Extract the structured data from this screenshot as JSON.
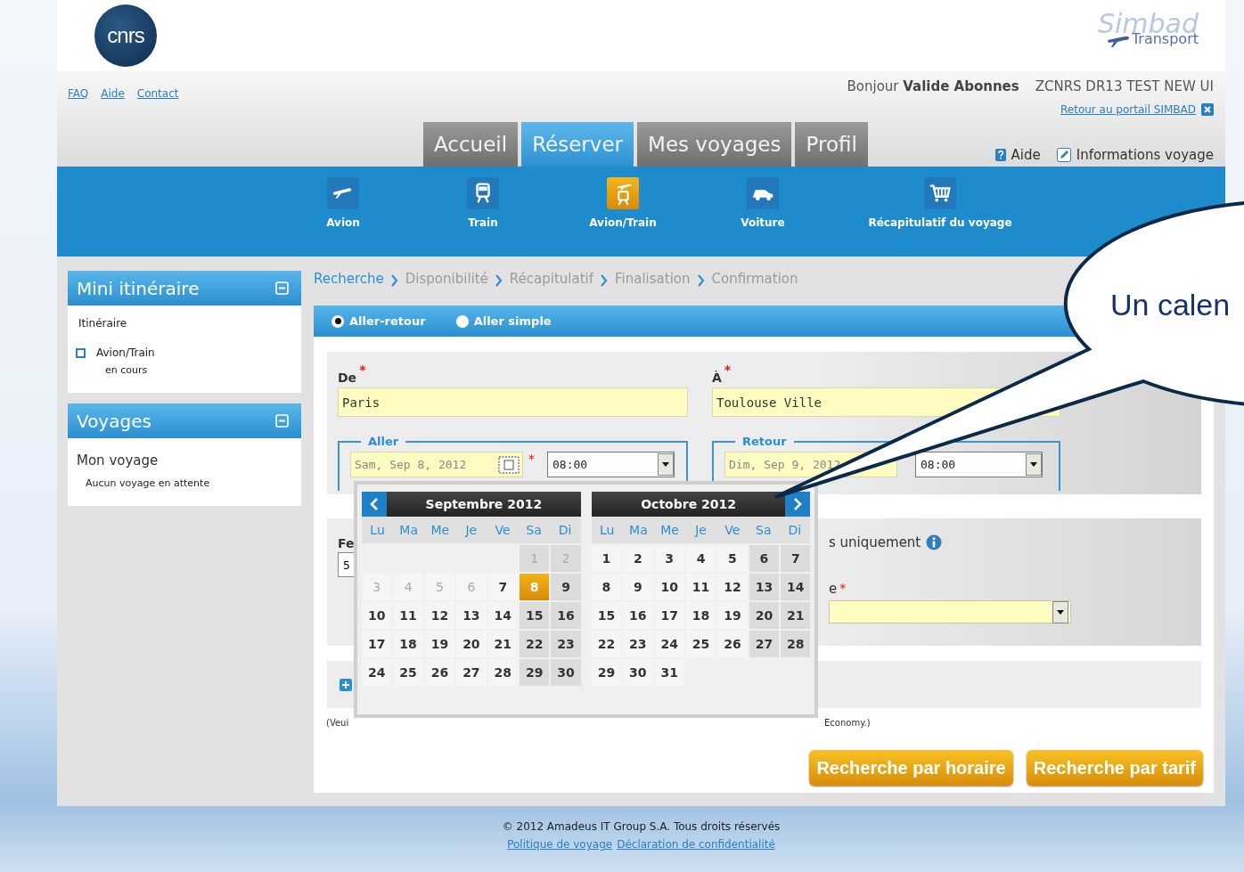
{
  "header": {
    "logo_text": "cnrs",
    "brand_logo": [
      "Simbad",
      "Transport"
    ]
  },
  "top_links": [
    "FAQ",
    "Aide",
    "Contact"
  ],
  "greeting": "Bonjour **Valide Abonnes**",
  "organization": "ZCNRS DR13 TEST NEW UI",
  "portal_link": "Retour au portail SIMBAD",
  "tabs": [
    {
      "label": "Accueil",
      "selected": false
    },
    {
      "label": "Réserver",
      "selected": true
    },
    {
      "label": "Mes voyages",
      "selected": false
    },
    {
      "label": "Profil",
      "selected": false
    }
  ],
  "utility_links": [
    {
      "kind": "help",
      "label": "Aide"
    },
    {
      "kind": "info",
      "label": "Informations voyage"
    }
  ],
  "modes": [
    {
      "kind": "plane",
      "label": "Avion",
      "selected": false
    },
    {
      "kind": "train",
      "label": "Train",
      "selected": false
    },
    {
      "kind": "plane_train",
      "label": "Avion/Train",
      "selected": true
    },
    {
      "kind": "car",
      "label": "Voiture",
      "selected": false
    },
    {
      "kind": "cart",
      "label": "Récapitulatif du voyage",
      "selected": false
    }
  ],
  "sidebar": {
    "itinerary": {
      "title": "Mini itinéraire",
      "heading": "Itinéraire",
      "trip": "Avion/Train",
      "status": "en cours"
    },
    "trips": {
      "title": "Voyages",
      "heading": "Mon voyage",
      "note": "Aucun voyage en attente"
    }
  },
  "breadcrumb": [
    {
      "label": "Recherche",
      "selected": true
    },
    {
      "label": "Disponibilité",
      "selected": false
    },
    {
      "label": "Récapitulatif",
      "selected": false
    },
    {
      "label": "Finalisation",
      "selected": false
    },
    {
      "label": "Confirmation",
      "selected": false
    }
  ],
  "trip_type": [
    {
      "label": "Aller-retour",
      "selected": true
    },
    {
      "label": "Aller simple",
      "selected": false
    }
  ],
  "from": {
    "label": "De",
    "required_mark": "*",
    "value": "Paris"
  },
  "to": {
    "label": "À",
    "required_mark": "*",
    "value": "Toulouse Ville"
  },
  "outbound": {
    "legend": "Aller",
    "date": "Sam, Sep 8, 2012",
    "calendar_button": true,
    "required_mark": "*",
    "time": "08:00"
  },
  "return": {
    "legend": "Retour",
    "date": "Dim, Sep 9, 2012",
    "calendar_button": false,
    "time": "08:00"
  },
  "partial": {
    "left_label": "Fe",
    "left_value": "5",
    "right_text": "s uniquement",
    "right_label": "e",
    "right_required_mark": "*",
    "note_left": "(Veui",
    "note_right": "Economy.)"
  },
  "buttons": [
    "Recherche par horaire",
    "Recherche par tarif"
  ],
  "calendar": {
    "months": [
      {
        "title": "Septembre 2012",
        "weekdays": [
          "Lu",
          "Ma",
          "Me",
          "Je",
          "Ve",
          "Sa",
          "Di"
        ],
        "weeks": [
          [
            {
              "day": "1",
              "disabled": true,
              "selected": false
            },
            {
              "day": "2",
              "disabled": true,
              "selected": false
            }
          ],
          [
            {
              "day": "3",
              "disabled": true,
              "selected": false
            },
            {
              "day": "4",
              "disabled": true,
              "selected": false
            },
            {
              "day": "5",
              "disabled": true,
              "selected": false
            },
            {
              "day": "6",
              "disabled": true,
              "selected": false
            },
            {
              "day": "7",
              "disabled": false,
              "selected": false
            },
            {
              "day": "8",
              "disabled": false,
              "selected": true
            },
            {
              "day": "9",
              "disabled": false,
              "selected": false
            }
          ],
          [
            {
              "day": "10",
              "disabled": false,
              "selected": false
            },
            {
              "day": "11",
              "disabled": false,
              "selected": false
            },
            {
              "day": "12",
              "disabled": false,
              "selected": false
            },
            {
              "day": "13",
              "disabled": false,
              "selected": false
            },
            {
              "day": "14",
              "disabled": false,
              "selected": false
            },
            {
              "day": "15",
              "disabled": false,
              "selected": false
            },
            {
              "day": "16",
              "disabled": false,
              "selected": false
            }
          ],
          [
            {
              "day": "17",
              "disabled": false,
              "selected": false
            },
            {
              "day": "18",
              "disabled": false,
              "selected": false
            },
            {
              "day": "19",
              "disabled": false,
              "selected": false
            },
            {
              "day": "20",
              "disabled": false,
              "selected": false
            },
            {
              "day": "21",
              "disabled": false,
              "selected": false
            },
            {
              "day": "22",
              "disabled": false,
              "selected": false
            },
            {
              "day": "23",
              "disabled": false,
              "selected": false
            }
          ],
          [
            {
              "day": "24",
              "disabled": false,
              "selected": false
            },
            {
              "day": "25",
              "disabled": false,
              "selected": false
            },
            {
              "day": "26",
              "disabled": false,
              "selected": false
            },
            {
              "day": "27",
              "disabled": false,
              "selected": false
            },
            {
              "day": "28",
              "disabled": false,
              "selected": false
            },
            {
              "day": "29",
              "disabled": false,
              "selected": false
            },
            {
              "day": "30",
              "disabled": false,
              "selected": false
            }
          ]
        ]
      },
      {
        "title": "Octobre 2012",
        "weekdays": [
          "Lu",
          "Ma",
          "Me",
          "Je",
          "Ve",
          "Sa",
          "Di"
        ],
        "weeks": [
          [
            {
              "day": "1",
              "disabled": false,
              "selected": false
            },
            {
              "day": "2",
              "disabled": false,
              "selected": false
            },
            {
              "day": "3",
              "disabled": false,
              "selected": false
            },
            {
              "day": "4",
              "disabled": false,
              "selected": false
            },
            {
              "day": "5",
              "disabled": false,
              "selected": false
            },
            {
              "day": "6",
              "disabled": false,
              "selected": false
            },
            {
              "day": "7",
              "disabled": false,
              "selected": false
            }
          ],
          [
            {
              "day": "8",
              "disabled": false,
              "selected": false
            },
            {
              "day": "9",
              "disabled": false,
              "selected": false
            },
            {
              "day": "10",
              "disabled": false,
              "selected": false
            },
            {
              "day": "11",
              "disabled": false,
              "selected": false
            },
            {
              "day": "12",
              "disabled": false,
              "selected": false
            },
            {
              "day": "13",
              "disabled": false,
              "selected": false
            },
            {
              "day": "14",
              "disabled": false,
              "selected": false
            }
          ],
          [
            {
              "day": "15",
              "disabled": false,
              "selected": false
            },
            {
              "day": "16",
              "disabled": false,
              "selected": false
            },
            {
              "day": "17",
              "disabled": false,
              "selected": false
            },
            {
              "day": "18",
              "disabled": false,
              "selected": false
            },
            {
              "day": "19",
              "disabled": false,
              "selected": false
            },
            {
              "day": "20",
              "disabled": false,
              "selected": false
            },
            {
              "day": "21",
              "disabled": false,
              "selected": false
            }
          ],
          [
            {
              "day": "22",
              "disabled": false,
              "selected": false
            },
            {
              "day": "23",
              "disabled": false,
              "selected": false
            },
            {
              "day": "24",
              "disabled": false,
              "selected": false
            },
            {
              "day": "25",
              "disabled": false,
              "selected": false
            },
            {
              "day": "26",
              "disabled": false,
              "selected": false
            },
            {
              "day": "27",
              "disabled": false,
              "selected": false
            },
            {
              "day": "28",
              "disabled": false,
              "selected": false
            }
          ],
          [
            {
              "day": "29",
              "disabled": false,
              "selected": false
            },
            {
              "day": "30",
              "disabled": false,
              "selected": false
            },
            {
              "day": "31",
              "disabled": false,
              "selected": false
            }
          ]
        ]
      }
    ]
  },
  "footer": {
    "copyright": "© 2012 Amadeus IT Group S.A. Tous droits réservés",
    "links": [
      "Politique de voyage",
      "Déclaration de confidentialité"
    ]
  },
  "callout": {
    "text": "Un calen"
  }
}
